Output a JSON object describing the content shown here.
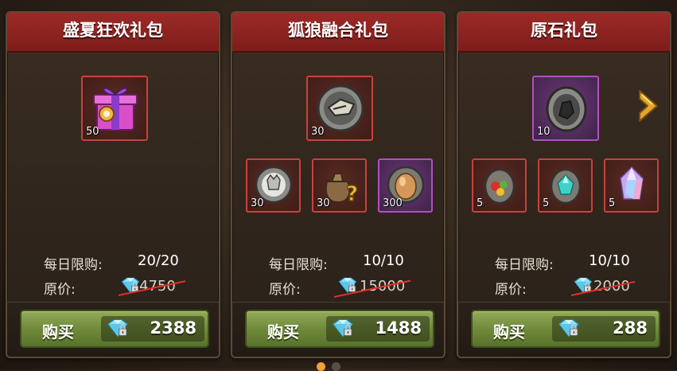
{
  "cards": [
    {
      "title": "盛夏狂欢礼包",
      "main_item": {
        "qty": "50",
        "icon": "gift-box-icon",
        "rarity": "red"
      },
      "sub_items": [],
      "daily_limit_label": "每日限购:",
      "daily_limit_value": "20/20",
      "original_price_label": "原价:",
      "original_price": "4750",
      "buy_label": "购买",
      "price": "2388"
    },
    {
      "title": "狐狼融合礼包",
      "main_item": {
        "qty": "30",
        "icon": "wolf-token-icon",
        "rarity": "red"
      },
      "sub_items": [
        {
          "qty": "30",
          "icon": "wolf-head-token-icon",
          "rarity": "red"
        },
        {
          "qty": "30",
          "icon": "mystery-bag-icon",
          "rarity": "red"
        },
        {
          "qty": "300",
          "icon": "egg-icon",
          "rarity": "purple"
        }
      ],
      "daily_limit_label": "每日限购:",
      "daily_limit_value": "10/10",
      "original_price_label": "原价:",
      "original_price": "15000",
      "buy_label": "购买",
      "price": "1488"
    },
    {
      "title": "原石礼包",
      "main_item": {
        "qty": "10",
        "icon": "raw-stone-icon",
        "rarity": "purple"
      },
      "sub_items": [
        {
          "qty": "5",
          "icon": "fruit-stone-icon",
          "rarity": "red"
        },
        {
          "qty": "5",
          "icon": "cyan-gem-stone-icon",
          "rarity": "red"
        },
        {
          "qty": "5",
          "icon": "crystal-icon",
          "rarity": "red"
        }
      ],
      "daily_limit_label": "每日限购:",
      "daily_limit_value": "10/10",
      "original_price_label": "原价:",
      "original_price": "2000",
      "buy_label": "购买",
      "price": "288"
    }
  ],
  "next_arrow_icon": "chevron-right-icon",
  "currency_icon": "diamond-lock-icon",
  "colors": {
    "header_red": "#8e2421",
    "buy_green": "#7a9442",
    "rarity_red": "#c8423d",
    "rarity_purple": "#b24fc2",
    "arrow_gold": "#e3a52a"
  },
  "pagination": {
    "active_index": 0,
    "count": 2
  }
}
